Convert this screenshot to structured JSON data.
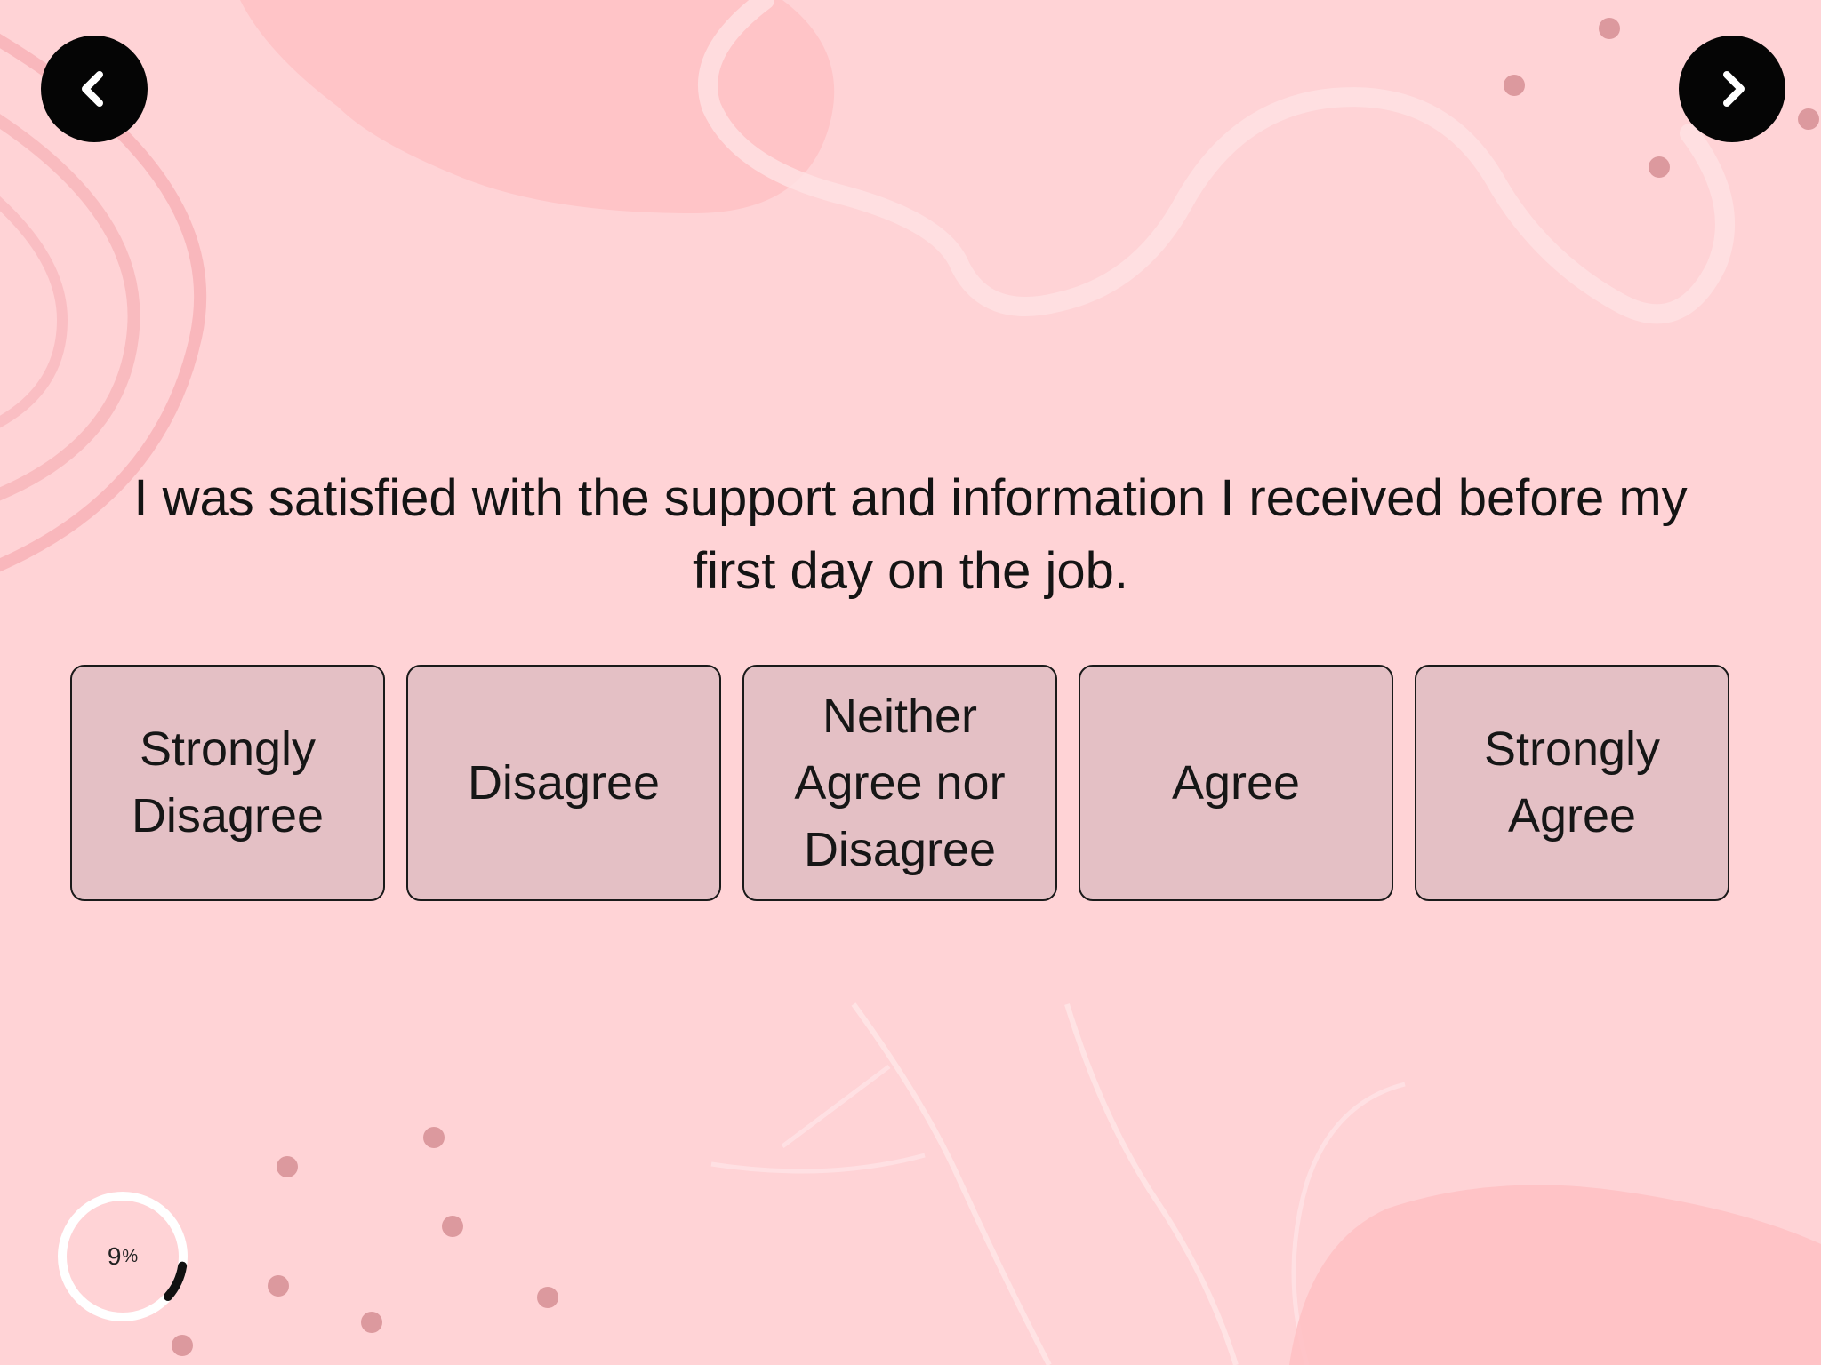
{
  "nav": {
    "prev_icon": "chevron-left-icon",
    "next_icon": "chevron-right-icon"
  },
  "question": {
    "line1": "I was satisfied with the support and information I received before my",
    "line2": "first day on the job."
  },
  "options": [
    {
      "line1": "Strongly",
      "line2": "Disagree",
      "line3": ""
    },
    {
      "line1": "Disagree",
      "line2": "",
      "line3": ""
    },
    {
      "line1": "Neither",
      "line2": "Agree nor",
      "line3": "Disagree"
    },
    {
      "line1": "Agree",
      "line2": "",
      "line3": ""
    },
    {
      "line1": "Strongly",
      "line2": "Agree",
      "line3": ""
    }
  ],
  "progress": {
    "value": "9",
    "unit": "%",
    "fraction": 0.09
  },
  "colors": {
    "background": "#ffd3d6",
    "option_fill": "#e4c0c5",
    "nav_button": "#050505",
    "progress_ring": "#ffffff",
    "progress_arc": "#111111"
  }
}
